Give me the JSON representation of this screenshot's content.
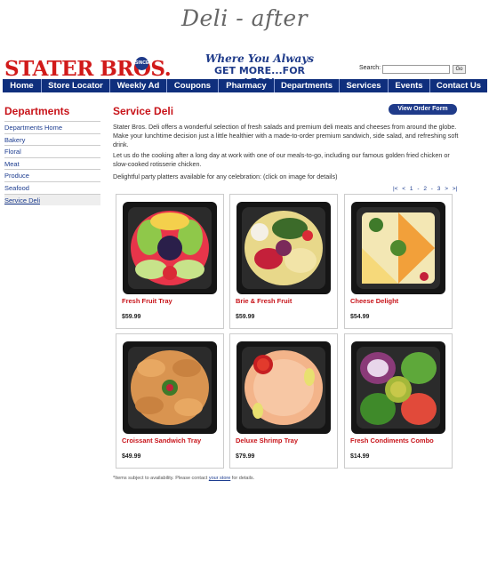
{
  "caption": "Deli - after",
  "header": {
    "logo_text": "STATER BROS.",
    "logo_badge": "SINCE",
    "tagline_line1": "Where You Always",
    "tagline_line2": "GET MORE...FOR LESS!",
    "search_label": "Search:",
    "search_value": "",
    "search_button": "Go"
  },
  "nav": [
    "Home",
    "Store Locator",
    "Weekly Ad",
    "Coupons",
    "Pharmacy",
    "Departments",
    "Services",
    "Events",
    "Contact Us"
  ],
  "sidebar": {
    "title": "Departments",
    "items": [
      "Departments Home",
      "Bakery",
      "Floral",
      "Meat",
      "Produce",
      "Seafood",
      "Service Deli"
    ],
    "active": "Service Deli"
  },
  "main": {
    "title": "Service Deli",
    "order_button": "View Order Form",
    "para1": "Stater Bros. Deli offers a wonderful selection of fresh salads and premium deli meats and cheeses from around the globe. Make your lunchtime decision just a little healthier with a made-to-order premium sandwich, side salad, and refreshing soft drink.",
    "para2": "Let us do the cooking after a long day at work with one of our meals-to-go, including our famous golden fried chicken or slow-cooked rotisserie chicken.",
    "para3": "Delightful party platters available for any celebration:  (click on image for details)",
    "pager": [
      "|<",
      "<",
      "1",
      "-",
      "2",
      "-",
      "3",
      ">",
      ">|"
    ],
    "products": [
      {
        "name": "Fresh Fruit Tray",
        "price": "$59.99",
        "image_icon": "fruit-tray-image"
      },
      {
        "name": "Brie & Fresh Fruit",
        "price": "$59.99",
        "image_icon": "brie-tray-image"
      },
      {
        "name": "Cheese Delight",
        "price": "$54.99",
        "image_icon": "cheese-tray-image"
      },
      {
        "name": "Croissant Sandwich Tray",
        "price": "$49.99",
        "image_icon": "croissant-tray-image"
      },
      {
        "name": "Deluxe Shrimp Tray",
        "price": "$79.99",
        "image_icon": "shrimp-tray-image"
      },
      {
        "name": "Fresh Condiments Combo",
        "price": "$14.99",
        "image_icon": "condiments-tray-image"
      }
    ],
    "footnote_pre": "*Items subject to availability. Please contact ",
    "footnote_link": "your store",
    "footnote_post": " for details."
  },
  "colors": {
    "brand_red": "#c8141a",
    "nav_blue": "#0f2f7d",
    "link_blue": "#1c3c8f"
  }
}
